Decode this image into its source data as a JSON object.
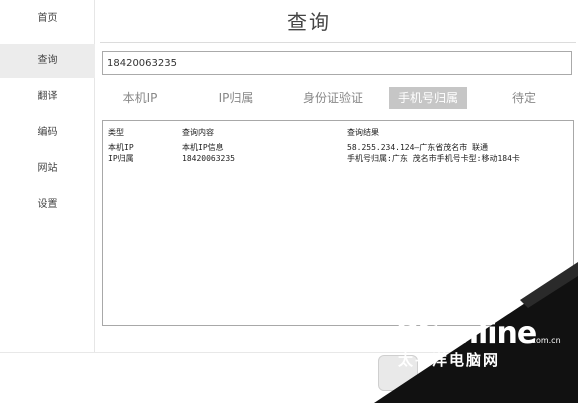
{
  "sidebar": {
    "items": [
      {
        "label": "首页"
      },
      {
        "label": "查询"
      },
      {
        "label": "翻译"
      },
      {
        "label": "编码"
      },
      {
        "label": "网站"
      },
      {
        "label": "设置"
      }
    ],
    "active_index": 1
  },
  "main": {
    "title": "查询",
    "search": {
      "value": "18420063235"
    },
    "tabs": [
      {
        "label": "本机IP"
      },
      {
        "label": "IP归属"
      },
      {
        "label": "身份证验证"
      },
      {
        "label": "手机号归属"
      },
      {
        "label": "待定"
      }
    ],
    "active_tab_index": 3,
    "results": {
      "columns": [
        "类型",
        "查询内容",
        "查询结果"
      ],
      "rows": [
        [
          "本机IP",
          "本机IP信息",
          "58.255.234.124—广东省茂名市 联通"
        ],
        [
          "IP归属",
          "18420063235",
          "手机号归属:广东 茂名市手机号卡型:移动184卡"
        ]
      ]
    }
  },
  "watermark": {
    "logo": "PConline",
    "domain": ".com.cn",
    "sub": "太平洋电脑网"
  },
  "colors": {
    "active_tab_bg": "#c6c6c6",
    "active_nav_bg": "#ececec",
    "watermark_bg": "#111111"
  }
}
